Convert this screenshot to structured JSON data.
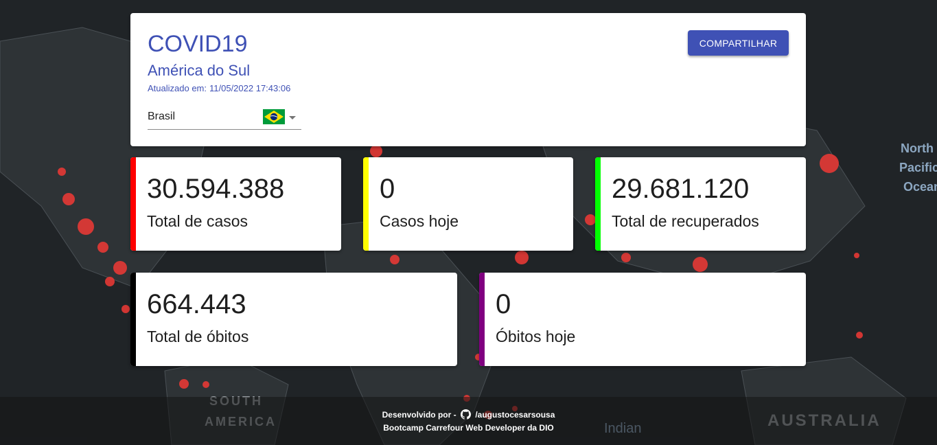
{
  "header": {
    "title": "COVID19",
    "subtitle": "América do Sul",
    "updated_label": "Atualizado em:",
    "updated_value": "11/05/2022 17:43:06",
    "country_value": "Brasil",
    "share_label": "COMPARTILHAR"
  },
  "stats": {
    "total_cases": {
      "value": "30.594.388",
      "label": "Total de casos",
      "color": "#ff0000"
    },
    "cases_today": {
      "value": "0",
      "label": "Casos hoje",
      "color": "#ffff00"
    },
    "total_recovered": {
      "value": "29.681.120",
      "label": "Total de recuperados",
      "color": "#00ff00"
    },
    "total_deaths": {
      "value": "664.443",
      "label": "Total de óbitos",
      "color": "#000000"
    },
    "deaths_today": {
      "value": "0",
      "label": "Óbitos hoje",
      "color": "#800080"
    }
  },
  "footer": {
    "developed_by": "Desenvolvido por -",
    "github_handle": "/augustocesarsousa",
    "credits": "Bootcamp Carrefour Web Developer da DIO"
  },
  "background_labels": {
    "north_pacific": "North Pacific Ocean",
    "south_america": "SOUTH AMERICA",
    "indian_ocean": "Indian Ocean",
    "australia": "AUSTRALIA"
  },
  "colors": {
    "accent": "#3f51b5"
  }
}
